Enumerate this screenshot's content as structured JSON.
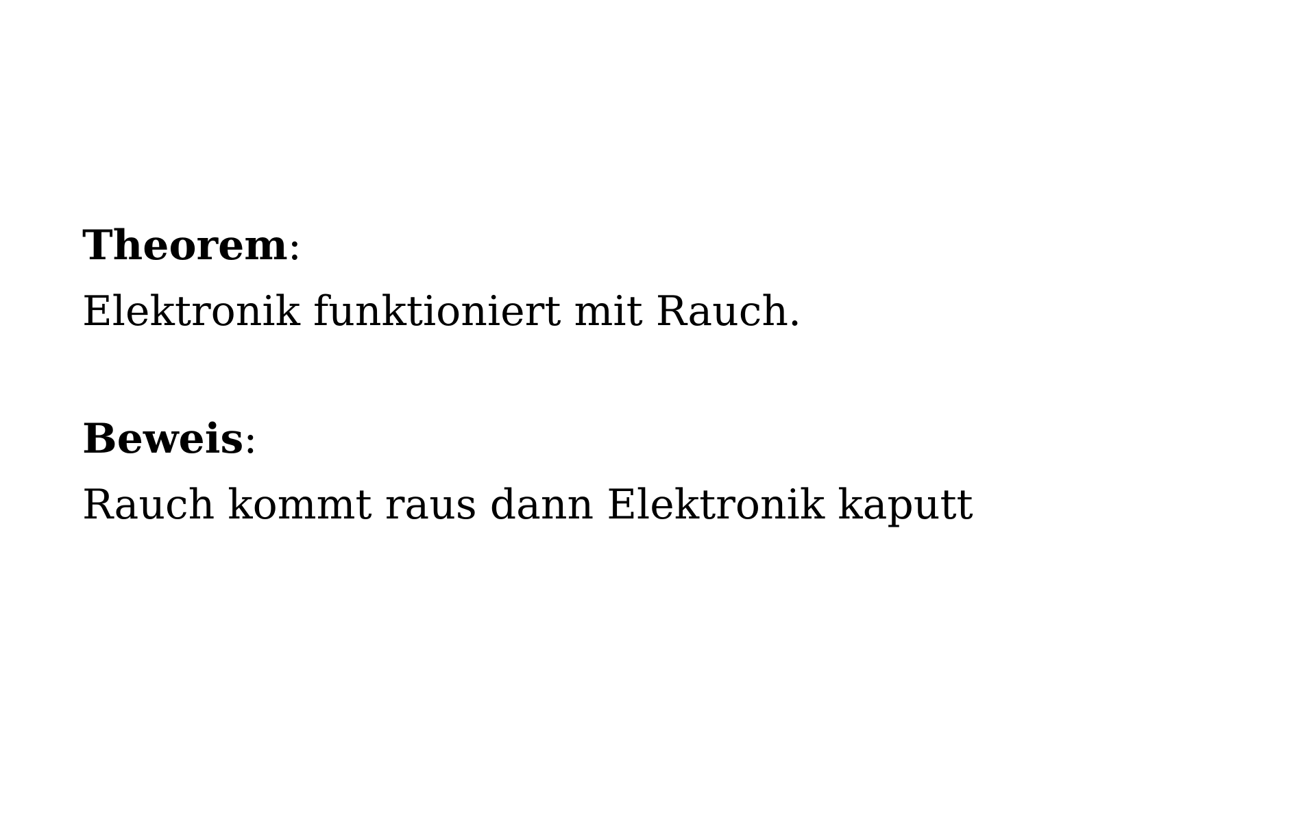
{
  "document": {
    "sections": [
      {
        "heading": "Theorem",
        "separator": ":",
        "text": "Elektronik funktioniert mit Rauch."
      },
      {
        "heading": "Beweis",
        "separator": ":",
        "text": "Rauch kommt raus dann Elektronik kaputt"
      }
    ]
  }
}
